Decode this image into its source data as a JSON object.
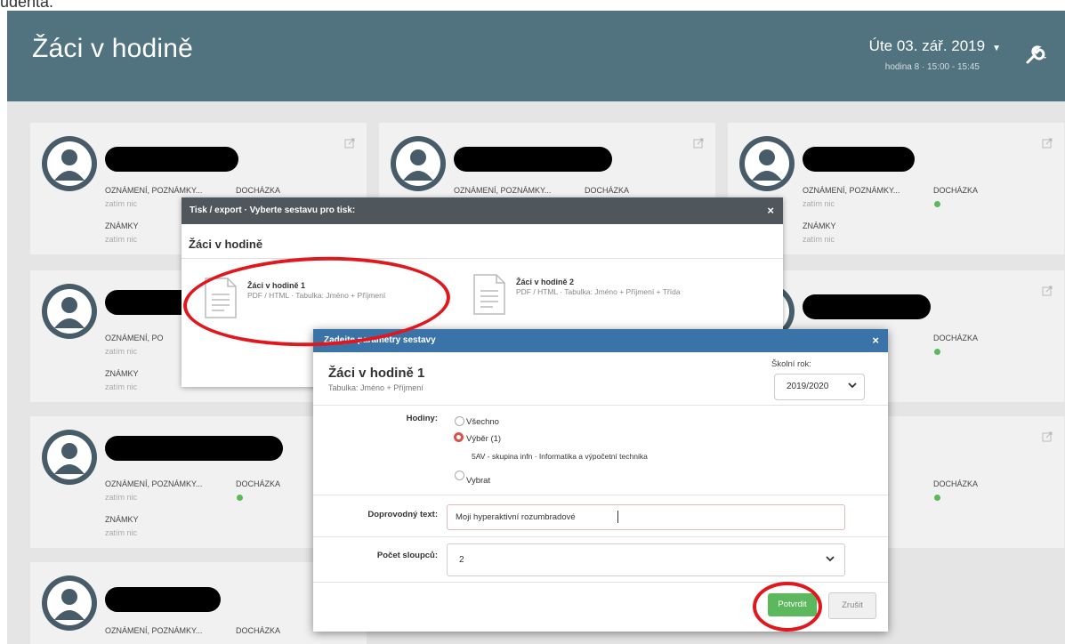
{
  "top_text": "udenta.",
  "header": {
    "title": "Žáci v hodině",
    "date": "Úte 03. zář. 2019",
    "lesson": "hodina 8 · 15:00 - 15:45"
  },
  "card_labels": {
    "announcements": "OZNÁMENÍ, POZNÁMKY...",
    "attendance": "DOCHÁZKA",
    "nothing": "zatím nic",
    "grades": "ZNÁMKY"
  },
  "export_modal": {
    "header": "Tisk / export · Vyberte sestavu pro tisk:",
    "close": "×",
    "section": "Žáci v hodině",
    "reports": [
      {
        "title": "Žáci v hodině 1",
        "desc": "PDF / HTML · Tabulka: Jméno + Příjmení"
      },
      {
        "title": "Žáci v hodině 2",
        "desc": "PDF / HTML · Tabulka: Jméno + Příjmení + Třída"
      }
    ]
  },
  "params_modal": {
    "header": "Zadejte parametry sestavy",
    "close": "×",
    "title": "Žáci v hodině 1",
    "subtitle": "Tabulka: Jméno + Příjmení",
    "year_label": "Školní rok:",
    "year_value": "2019/2020",
    "hours_label": "Hodiny:",
    "opt_all": "Všechno",
    "opt_selection": "Výběr (1)",
    "selection_desc": "5AV - skupina infn · Informatika a výpočetní technika",
    "opt_choose": "Vybrat",
    "text_label": "Doprovodný text:",
    "text_value": "Moji hyperaktivní rozumbradové",
    "columns_label": "Počet sloupců:",
    "columns_value": "2",
    "confirm": "Potvrdit",
    "cancel": "Zrušit"
  },
  "colors": {
    "header_bg": "#50737f",
    "params_header_bg": "#3a73a8",
    "export_header_bg": "#50575c",
    "confirm_bg": "#5cb85c",
    "annotation": "#e0181e",
    "attendance_dot": "#5cb85c"
  }
}
